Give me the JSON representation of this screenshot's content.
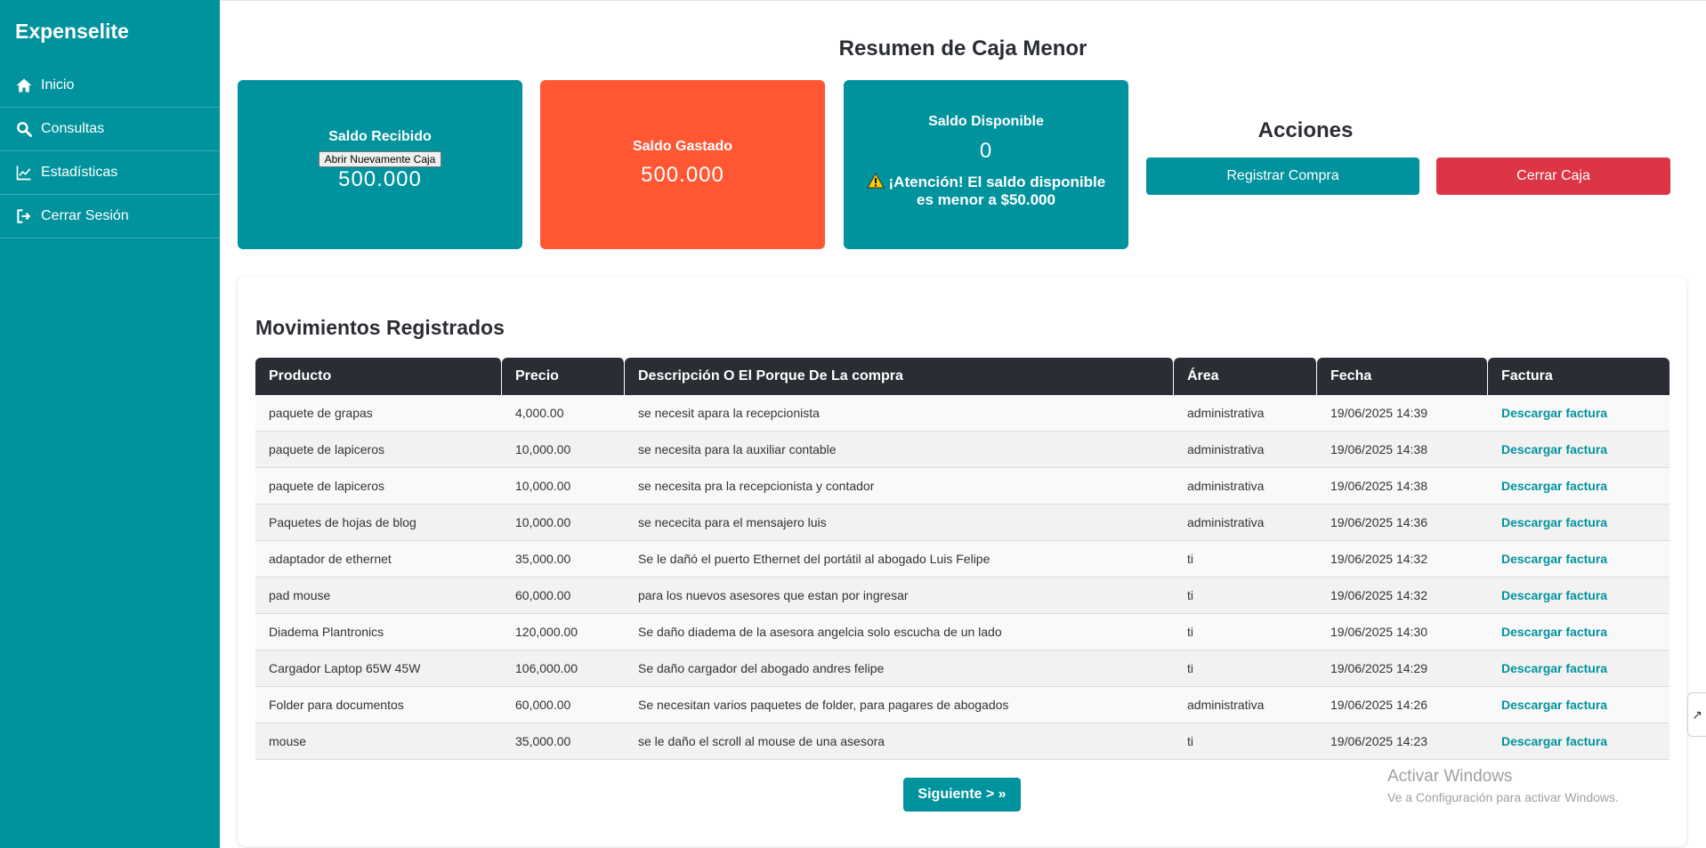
{
  "app": {
    "brand": "Expenselite"
  },
  "sidebar": {
    "items": [
      {
        "label": "Inicio",
        "icon": "home-icon"
      },
      {
        "label": "Consultas",
        "icon": "search-icon"
      },
      {
        "label": "Estadísticas",
        "icon": "chart-icon"
      },
      {
        "label": "Cerrar Sesión",
        "icon": "logout-icon"
      }
    ]
  },
  "summary": {
    "title": "Resumen de Caja Menor",
    "received": {
      "label": "Saldo Recibido",
      "button": "Abrir Nuevamente Caja",
      "value": "500.000"
    },
    "spent": {
      "label": "Saldo Gastado",
      "value": "500.000"
    },
    "available": {
      "label": "Saldo Disponible",
      "value": "0",
      "warning": "¡Atención! El saldo disponible es menor a $50.000"
    }
  },
  "actions": {
    "title": "Acciones",
    "register": "Registrar Compra",
    "close": "Cerrar Caja"
  },
  "movements": {
    "title": "Movimientos Registrados",
    "columns": [
      "Producto",
      "Precio",
      "Descripción O El Porque De La compra",
      "Área",
      "Fecha",
      "Factura"
    ],
    "rows": [
      [
        "paquete de grapas",
        "4,000.00",
        "se necesit apara la recepcionista",
        "administrativa",
        "19/06/2025 14:39",
        "Descargar factura"
      ],
      [
        "paquete de lapiceros",
        "10,000.00",
        "se necesita para la auxiliar contable",
        "administrativa",
        "19/06/2025 14:38",
        "Descargar factura"
      ],
      [
        "paquete de lapiceros",
        "10,000.00",
        "se necesita pra la recepcionista y contador",
        "administrativa",
        "19/06/2025 14:38",
        "Descargar factura"
      ],
      [
        "Paquetes de hojas de blog",
        "10,000.00",
        "se nececita para el mensajero luis",
        "administrativa",
        "19/06/2025 14:36",
        "Descargar factura"
      ],
      [
        "adaptador de ethernet",
        "35,000.00",
        "Se le dañó el puerto Ethernet del portátil al abogado Luis Felipe",
        "ti",
        "19/06/2025 14:32",
        "Descargar factura"
      ],
      [
        "pad mouse",
        "60,000.00",
        "para los nuevos asesores que estan por ingresar",
        "ti",
        "19/06/2025 14:32",
        "Descargar factura"
      ],
      [
        "Diadema Plantronics",
        "120,000.00",
        "Se daño diadema de la asesora angelcia solo escucha de un lado",
        "ti",
        "19/06/2025 14:30",
        "Descargar factura"
      ],
      [
        "Cargador Laptop 65W 45W",
        "106,000.00",
        "Se daño cargador del abogado andres felipe",
        "ti",
        "19/06/2025 14:29",
        "Descargar factura"
      ],
      [
        "Folder para documentos",
        "60,000.00",
        "Se necesitan varios paquetes de folder, para pagares de abogados",
        "administrativa",
        "19/06/2025 14:26",
        "Descargar factura"
      ],
      [
        "mouse",
        "35,000.00",
        "se le daño el scroll al mouse de una asesora",
        "ti",
        "19/06/2025 14:23",
        "Descargar factura"
      ]
    ],
    "next": "Siguiente > »"
  },
  "watermark": {
    "line1": "Activar Windows",
    "line2": "Ve a Configuración para activar Windows."
  },
  "colors": {
    "teal": "#00939e",
    "orange": "#ff5733",
    "red": "#dc3545",
    "dark": "#2b2d35"
  }
}
